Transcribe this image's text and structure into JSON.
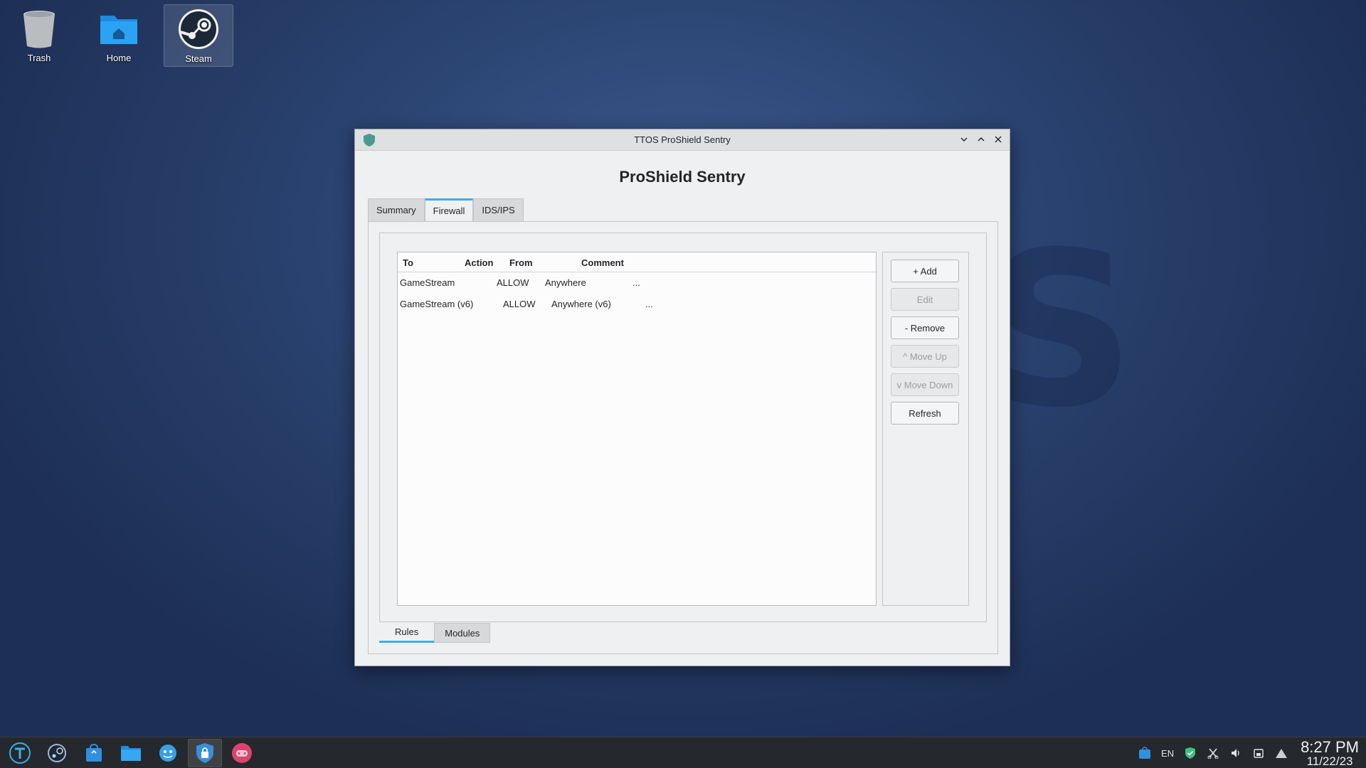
{
  "desktop": {
    "icons": [
      {
        "label": "Trash"
      },
      {
        "label": "Home"
      },
      {
        "label": "Steam"
      }
    ]
  },
  "window": {
    "title": "TTOS ProShield Sentry",
    "heading": "ProShield Sentry",
    "tabs": [
      {
        "label": "Summary",
        "active": false
      },
      {
        "label": "Firewall",
        "active": true
      },
      {
        "label": "IDS/IPS",
        "active": false
      }
    ],
    "table": {
      "columns": [
        "To",
        "Action",
        "From",
        "Comment"
      ],
      "rows": [
        {
          "to": "GameStream",
          "action": "ALLOW",
          "from": "Anywhere",
          "comment": "..."
        },
        {
          "to": "GameStream (v6)",
          "action": "ALLOW",
          "from": "Anywhere (v6)",
          "comment": "..."
        }
      ]
    },
    "buttons": {
      "add": "+ Add",
      "edit": "Edit",
      "remove": "- Remove",
      "move_up": "^ Move Up",
      "move_down": "v Move Down",
      "refresh": "Refresh"
    },
    "bottom_tabs": [
      {
        "label": "Rules",
        "active": true
      },
      {
        "label": "Modules",
        "active": false
      }
    ]
  },
  "taskbar": {
    "language": "EN",
    "time": "8:27 PM",
    "date": "11/22/23"
  },
  "colors": {
    "accent": "#3daee9",
    "shield": "#4a9a8f"
  }
}
